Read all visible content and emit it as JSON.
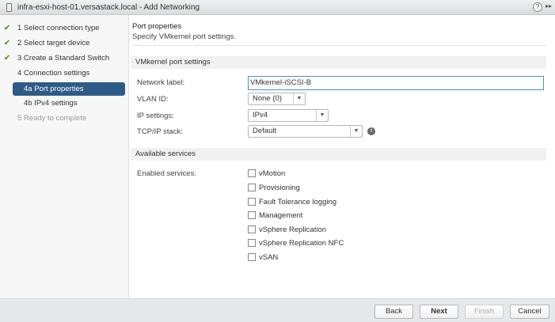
{
  "window": {
    "title": "infra-esxi-host-01.versastack.local - Add Networking"
  },
  "steps": [
    {
      "label": "1  Select connection type",
      "done": true
    },
    {
      "label": "2  Select target device",
      "done": true
    },
    {
      "label": "3  Create a Standard Switch",
      "done": true
    },
    {
      "label": "4  Connection settings",
      "done": false
    },
    {
      "label": "4a  Port properties",
      "active": true
    },
    {
      "label": "4b  IPv4 settings"
    },
    {
      "label": "5  Ready to complete",
      "disabled": true
    }
  ],
  "check_glyph": "✔",
  "page": {
    "title": "Port properties",
    "subtitle": "Specify VMkernel port settings."
  },
  "vmk": {
    "header": "VMkernel port settings",
    "network_label": {
      "label": "Network label:",
      "value": "VMkernel-iSCSI-B"
    },
    "vlan": {
      "label": "VLAN ID:",
      "value": "None (0)"
    },
    "ip": {
      "label": "IP settings:",
      "value": "IPv4"
    },
    "tcpip": {
      "label": "TCP/IP stack:",
      "value": "Default"
    }
  },
  "services": {
    "header": "Available services",
    "label": "Enabled services:",
    "items": [
      "vMotion",
      "Provisioning",
      "Fault Tolerance logging",
      "Management",
      "vSphere Replication",
      "vSphere Replication NFC",
      "vSAN"
    ]
  },
  "footer": {
    "back": "Back",
    "next": "Next",
    "finish": "Finish",
    "cancel": "Cancel"
  }
}
